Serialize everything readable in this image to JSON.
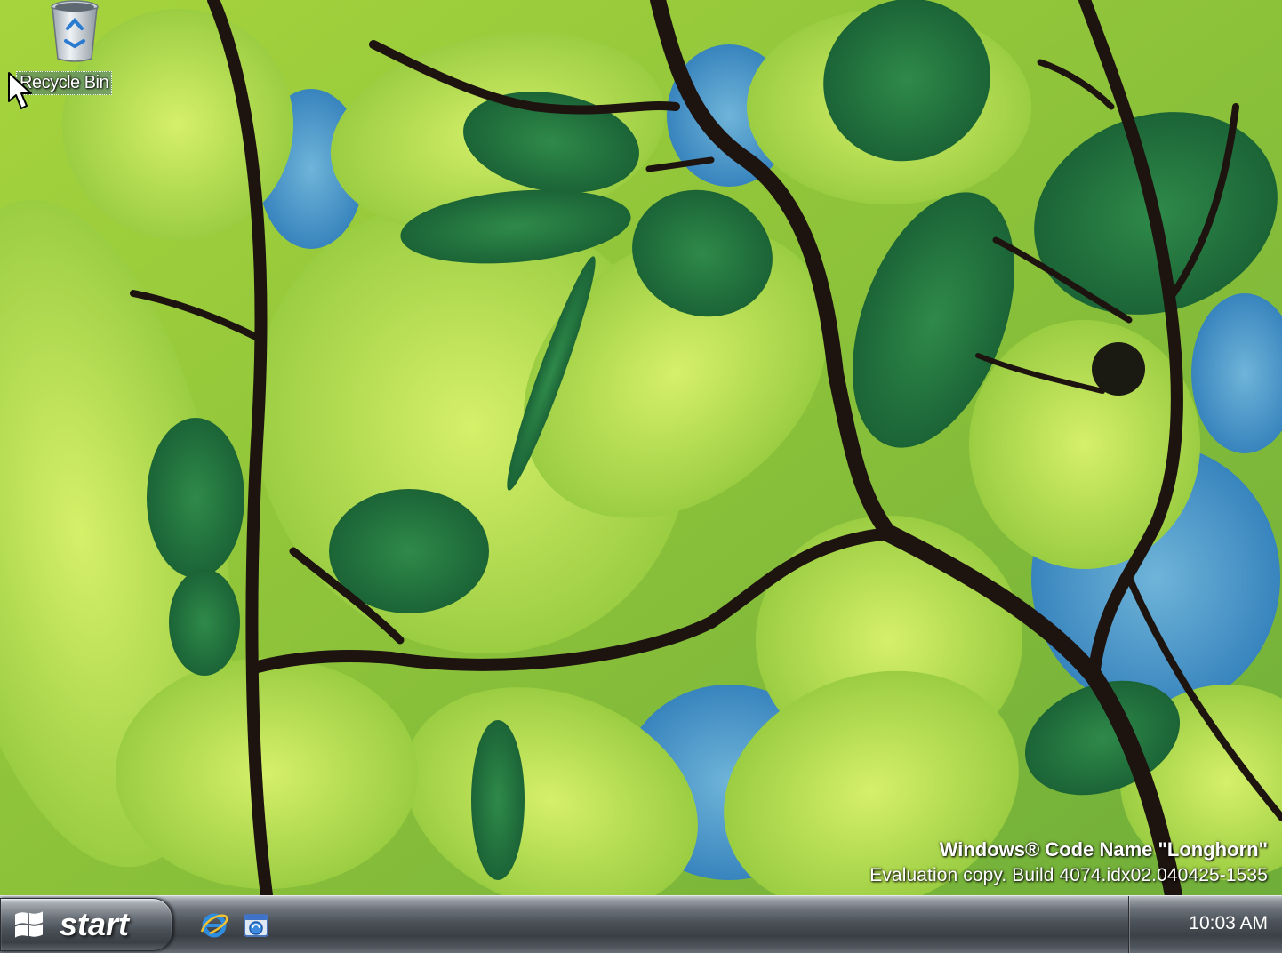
{
  "desktop": {
    "icons": [
      {
        "label": "Recycle Bin",
        "icon": "recycle-bin-icon"
      }
    ],
    "watermark": {
      "line1": "Windows® Code Name \"Longhorn\"",
      "line2": "Evaluation copy. Build 4074.idx02.040425-1535"
    },
    "wallpaper": "green-leaves-wallpaper"
  },
  "taskbar": {
    "start_label": "start",
    "quick_launch": [
      {
        "name": "internet-explorer-icon"
      },
      {
        "name": "show-desktop-icon"
      }
    ],
    "clock": "10:03 AM"
  },
  "colors": {
    "taskbar": "#4c5259",
    "leaf_light": "#b7e04a",
    "leaf_dark": "#1f6b3a",
    "branch": "#1e1410",
    "sky": "#3f8fc8"
  }
}
